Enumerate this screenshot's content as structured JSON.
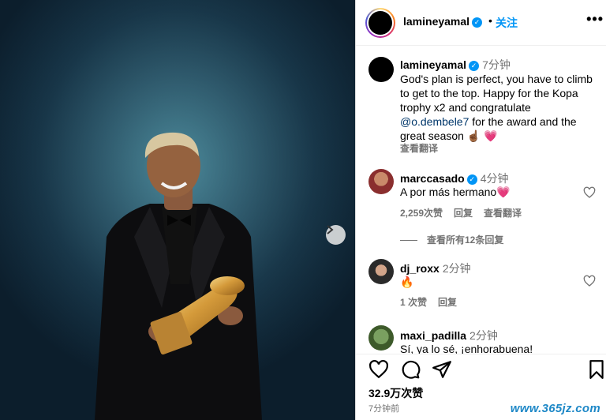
{
  "post": {
    "username": "lamineyamal",
    "follow_label": "关注",
    "more_icon": "more-horizontal-icon",
    "separator": "•"
  },
  "caption": {
    "username": "lamineyamal",
    "time": "7分钟",
    "text_before_mention": "God's plan is perfect, you have to climb to get to the top. Happy for the Kopa trophy x2 and congratulate",
    "mention": "@o.dembele7",
    "text_after_mention": " for the award and the great season",
    "emoji": "☝🏾 💗",
    "translate_label": "查看翻译"
  },
  "comments": [
    {
      "username": "marccasado",
      "verified": true,
      "time": "4分钟",
      "text": "A por más hermano💗",
      "likes": "2,259次赞",
      "reply": "回复",
      "translate": "查看翻译"
    },
    {
      "username": "dj_roxx",
      "verified": false,
      "time": "2分钟",
      "text": "🔥",
      "likes": "1 次赞",
      "reply": "回复"
    },
    {
      "username": "maxi_padilla",
      "verified": false,
      "time": "2分钟",
      "text": "Sí, ya lo sé, ¡enhorabuena!"
    }
  ],
  "view_replies": "查看所有12条回复",
  "actions": {
    "like_icon": "heart-icon",
    "comment_icon": "comment-icon",
    "share_icon": "send-icon",
    "save_icon": "bookmark-icon",
    "like_count": "32.9万次赞",
    "posted": "7分钟前"
  },
  "watermark": "www.365jz.com",
  "colors": {
    "accent": "#0095f6",
    "muted": "#737373",
    "mention": "#00376b",
    "like_red": "#ff3040"
  }
}
